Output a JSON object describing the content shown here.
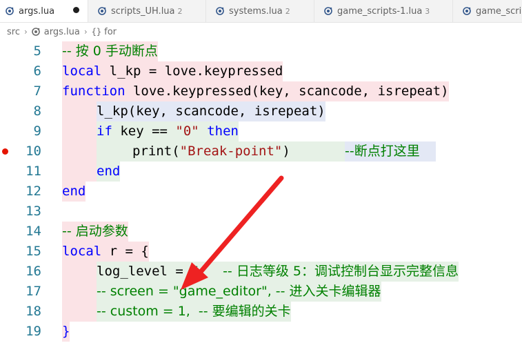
{
  "tabs": [
    {
      "label": "args.lua",
      "count": "",
      "active": true,
      "dirty": true
    },
    {
      "label": "scripts_UH.lua",
      "count": "2",
      "active": false,
      "dirty": false
    },
    {
      "label": "systems.lua",
      "count": "2",
      "active": false,
      "dirty": false
    },
    {
      "label": "game_scripts-1.lua",
      "count": "3",
      "active": false,
      "dirty": false
    },
    {
      "label": "game_scri",
      "count": "",
      "active": false,
      "dirty": false
    }
  ],
  "breadcrumb": {
    "folder": "src",
    "file": "args.lua",
    "symbol_icon": "{}",
    "symbol": "for"
  },
  "lines": [
    {
      "num": "5"
    },
    {
      "num": "6"
    },
    {
      "num": "7"
    },
    {
      "num": "8"
    },
    {
      "num": "9"
    },
    {
      "num": "10"
    },
    {
      "num": "11"
    },
    {
      "num": "12"
    },
    {
      "num": "13"
    },
    {
      "num": "14"
    },
    {
      "num": "15"
    },
    {
      "num": "16"
    },
    {
      "num": "17"
    },
    {
      "num": "18"
    },
    {
      "num": "19"
    }
  ],
  "code": {
    "l5_comment": "-- 按 0 手动断点",
    "l6_kw": "local",
    "l6_rest": " l_kp = love.keypressed",
    "l7_kw": "function",
    "l7_rest": " love.keypressed(key, scancode, isrepeat)",
    "l8_rest": "l_kp(key, scancode, isrepeat)",
    "l9_kw_if": "if",
    "l9_mid": " key == ",
    "l9_str": "\"0\"",
    "l9_sp": " ",
    "l9_kw_then": "then",
    "l10_fn": "print(",
    "l10_str": "\"Break-point\"",
    "l10_close": ")",
    "l10_comment": "--断点打这里",
    "l11_kw": "end",
    "l12_kw": "end",
    "l14_comment": "-- 启动参数",
    "l15_kw": "local",
    "l15_rest": " r = {",
    "l16_key": "log_level = ",
    "l16_num": "5",
    "l16_comma": ",  ",
    "l16_comment": "-- 日志等级 5：调试控制台显示完整信息",
    "l17_comment": "-- screen = \"game_editor\", -- 进入关卡编辑器",
    "l18_comment": "-- custom = 1,  -- 要编辑的关卡",
    "l19_rest": "}"
  },
  "colors": {
    "keyword": "#0000ff",
    "comment": "#008000",
    "string": "#a31515",
    "number": "#098658",
    "line_number": "#237893",
    "breakpoint": "#e51400",
    "arrow": "#ee2222"
  }
}
